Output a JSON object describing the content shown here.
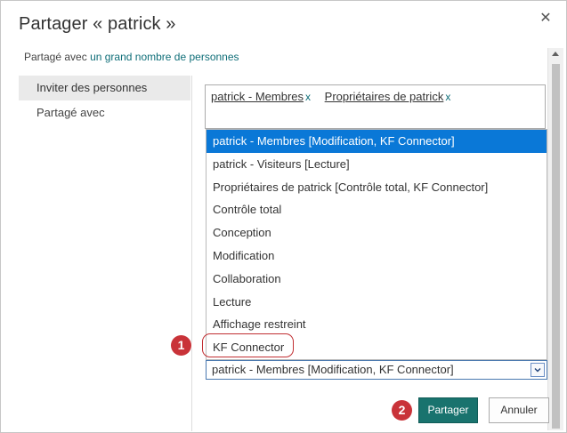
{
  "dialog": {
    "title": "Partager « patrick »",
    "close_symbol": "✕"
  },
  "shared_line": {
    "prefix": "Partagé avec",
    "link": "un grand nombre de personnes"
  },
  "side_nav": {
    "items": [
      {
        "label": "Inviter des personnes",
        "active": true
      },
      {
        "label": "Partagé avec",
        "active": false
      }
    ]
  },
  "people_picker": {
    "tokens": [
      {
        "label": "patrick - Membres",
        "remove": "x"
      },
      {
        "label": "Propriétaires de patrick",
        "remove": "x"
      }
    ]
  },
  "permission_dropdown": {
    "options": [
      "patrick - Membres [Modification, KF Connector]",
      "patrick - Visiteurs [Lecture]",
      "Propriétaires de patrick [Contrôle total, KF Connector]",
      "Contrôle total",
      "Conception",
      "Modification",
      "Collaboration",
      "Lecture",
      "Affichage restreint",
      "KF Connector"
    ],
    "selected_index": 0,
    "selected_value": "patrick - Membres [Modification, KF Connector]"
  },
  "callouts": {
    "step1": "1",
    "step2": "2"
  },
  "buttons": {
    "share": "Partager",
    "cancel": "Annuler"
  },
  "colors": {
    "accent": "#19736e",
    "selection": "#0a78d7",
    "callout": "#c93339",
    "link": "#0f6e78"
  }
}
